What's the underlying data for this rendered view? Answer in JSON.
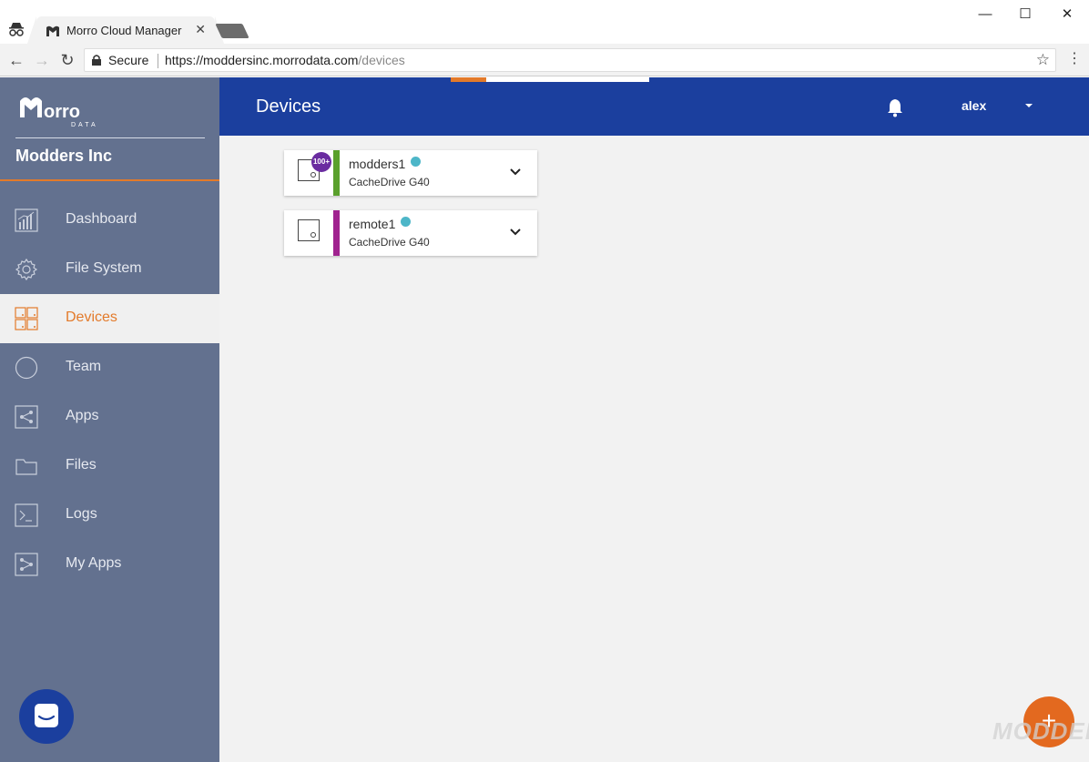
{
  "browser": {
    "tab_title": "Morro Cloud Manager",
    "tab_close": "✕",
    "secure_label": "Secure",
    "url_host": "https://moddersinc.morrodata.com",
    "url_path": "/devices",
    "window_controls": {
      "minimize": "—",
      "maximize": "☐",
      "close": "✕"
    },
    "nav": {
      "back": "←",
      "forward": "→",
      "reload": "↻"
    },
    "bookmark": "☆",
    "menu": "⋮"
  },
  "sidebar": {
    "org_name": "Modders Inc",
    "items": [
      {
        "label": "Dashboard",
        "icon": "bar-chart-icon"
      },
      {
        "label": "File System",
        "icon": "gear-icon"
      },
      {
        "label": "Devices",
        "icon": "grid-icon",
        "active": true
      },
      {
        "label": "Team",
        "icon": "circle-icon"
      },
      {
        "label": "Apps",
        "icon": "share-icon"
      },
      {
        "label": "Files",
        "icon": "folder-icon"
      },
      {
        "label": "Logs",
        "icon": "terminal-icon"
      },
      {
        "label": "My Apps",
        "icon": "flow-icon"
      }
    ]
  },
  "appbar": {
    "title": "Devices",
    "user": "alex",
    "progress": 0.18
  },
  "devices": [
    {
      "name": "modders1",
      "model": "CacheDrive G40",
      "badge": "100+",
      "bar_color": "#5aa02c",
      "status_color": "#4db6c8"
    },
    {
      "name": "remote1",
      "model": "CacheDrive G40",
      "badge": "",
      "bar_color": "#a0238f",
      "status_color": "#4db6c8"
    }
  ],
  "fab": {
    "label": "+"
  },
  "watermark": "MODDERS",
  "colors": {
    "accent": "#e37a2a",
    "appbar": "#1b3f9e",
    "sidebar": "#63718f"
  }
}
